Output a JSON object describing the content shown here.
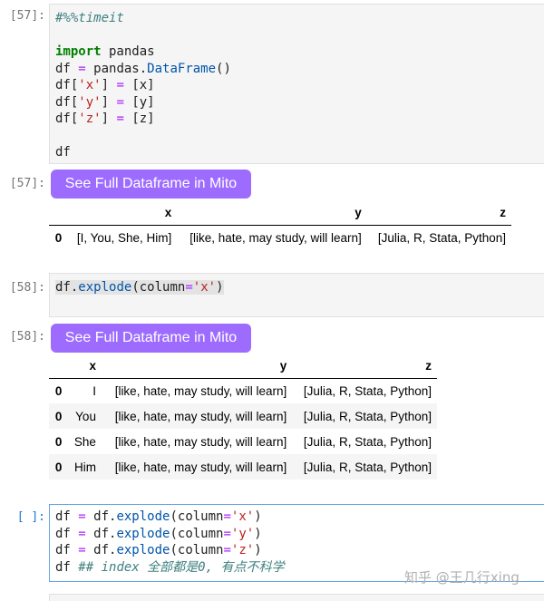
{
  "cells": [
    {
      "input_prompt": "[57]:",
      "output_prompt": "[57]:",
      "mito_button": "See Full Dataframe in Mito",
      "code": {
        "l1": "#%%timeit",
        "l3_kw": "import",
        "l3_rest": " pandas",
        "l4_a": "df ",
        "l4_op": "=",
        "l4_b": " pandas.",
        "l4_fn": "DataFrame",
        "l4_c": "()",
        "l5_a": "df[",
        "l5_s": "'x'",
        "l5_b": "] ",
        "l5_op": "=",
        "l5_c": " [x]",
        "l6_a": "df[",
        "l6_s": "'y'",
        "l6_b": "] ",
        "l6_op": "=",
        "l6_c": " [y]",
        "l7_a": "df[",
        "l7_s": "'z'",
        "l7_b": "] ",
        "l7_op": "=",
        "l7_c": " [z]",
        "l9": "df"
      },
      "table": {
        "headers": [
          "",
          "x",
          "y",
          "z"
        ],
        "rows": [
          [
            "0",
            "[I, You, She, Him]",
            "[like, hate, may study, will learn]",
            "[Julia, R, Stata, Python]"
          ]
        ]
      }
    },
    {
      "input_prompt": "[58]:",
      "output_prompt": "[58]:",
      "mito_button": "See Full Dataframe in Mito",
      "code": {
        "a": "df.",
        "fn": "explode",
        "b": "(column",
        "op": "=",
        "s": "'x'",
        "c": ")"
      },
      "table": {
        "headers": [
          "",
          "x",
          "y",
          "z"
        ],
        "rows": [
          [
            "0",
            "I",
            "[like, hate, may study, will learn]",
            "[Julia, R, Stata, Python]"
          ],
          [
            "0",
            "You",
            "[like, hate, may study, will learn]",
            "[Julia, R, Stata, Python]"
          ],
          [
            "0",
            "She",
            "[like, hate, may study, will learn]",
            "[Julia, R, Stata, Python]"
          ],
          [
            "0",
            "Him",
            "[like, hate, may study, will learn]",
            "[Julia, R, Stata, Python]"
          ]
        ]
      }
    },
    {
      "input_prompt": "[ ]:",
      "code": {
        "l1_a": "df ",
        "l1_op": "=",
        "l1_b": " df.",
        "l1_fn": "explode",
        "l1_c": "(column",
        "l1_op2": "=",
        "l1_s": "'x'",
        "l1_d": ")",
        "l2_a": "df ",
        "l2_op": "=",
        "l2_b": " df.",
        "l2_fn": "explode",
        "l2_c": "(column",
        "l2_op2": "=",
        "l2_s": "'y'",
        "l2_d": ")",
        "l3_a": "df ",
        "l3_op": "=",
        "l3_b": " df.",
        "l3_fn": "explode",
        "l3_c": "(column",
        "l3_op2": "=",
        "l3_s": "'z'",
        "l3_d": ")",
        "l4_a": "df ",
        "l4_comment": "## index 全部都是0, 有点不科学"
      }
    }
  ],
  "watermark": "知乎 @王几行xing",
  "colors": {
    "mito_button": "#9d6cff",
    "active_prompt": "#1976d2",
    "active_border": "#66a5e0"
  }
}
